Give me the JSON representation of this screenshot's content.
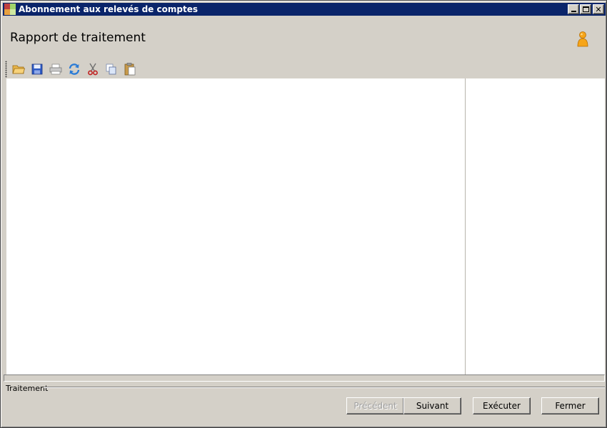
{
  "window": {
    "title": "Abonnement aux relevés de comptes",
    "controls": [
      "minimize-icon",
      "maximize-icon",
      "close-icon"
    ],
    "close_glyph": "✕"
  },
  "header": {
    "title": "Rapport de traitement",
    "user_icon": "user-icon"
  },
  "toolbar": {
    "items": [
      {
        "name": "open-folder-icon"
      },
      {
        "name": "save-icon"
      },
      {
        "name": "print-icon"
      },
      {
        "name": "refresh-icon"
      },
      {
        "name": "cut-icon"
      },
      {
        "name": "copy-icon"
      },
      {
        "name": "paste-icon"
      }
    ]
  },
  "footer": {
    "group_label": "Traitement",
    "buttons": {
      "previous": "Précédent",
      "next": "Suivant",
      "execute": "Exécuter",
      "close": "Fermer"
    }
  },
  "colors": {
    "titlebar": "#0a246a",
    "window_bg": "#d4d0c8",
    "pane_bg": "#ffffff"
  }
}
